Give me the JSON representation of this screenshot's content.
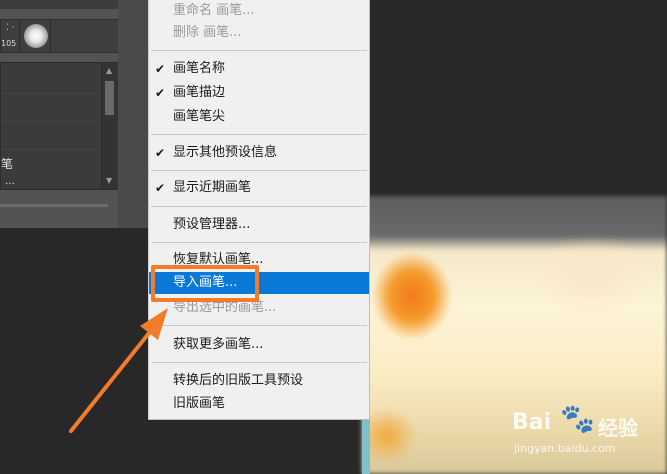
{
  "brush_panel": {
    "thumbnail_size": "105",
    "list_items": [
      "笔",
      "…"
    ]
  },
  "menu": {
    "items": [
      {
        "label": "重命名 画笔...",
        "checked": false,
        "disabled": true
      },
      {
        "label": "删除 画笔...",
        "checked": false,
        "disabled": true
      },
      {
        "label": "画笔名称",
        "checked": true,
        "disabled": false
      },
      {
        "label": "画笔描边",
        "checked": true,
        "disabled": false
      },
      {
        "label": "画笔笔尖",
        "checked": false,
        "disabled": false
      },
      {
        "label": "显示其他预设信息",
        "checked": true,
        "disabled": false
      },
      {
        "label": "显示近期画笔",
        "checked": true,
        "disabled": false
      },
      {
        "label": "预设管理器...",
        "checked": false,
        "disabled": false
      },
      {
        "label": "恢复默认画笔...",
        "checked": false,
        "disabled": false
      },
      {
        "label": "导入画笔...",
        "checked": false,
        "disabled": false,
        "highlighted": true
      },
      {
        "label": "导出选中的画笔...",
        "checked": false,
        "disabled": true
      },
      {
        "label": "获取更多画笔...",
        "checked": false,
        "disabled": false
      },
      {
        "label": "转换后的旧版工具预设",
        "checked": false,
        "disabled": false
      },
      {
        "label": "旧版画笔",
        "checked": false,
        "disabled": false
      }
    ],
    "check_glyph": "✔"
  },
  "watermark": {
    "logo_text": "Bai",
    "paw_glyph": "🐾",
    "cn_text": "经验",
    "url": "jingyan.baidu.com"
  },
  "colors": {
    "highlight": "#0a78d7",
    "annotation": "#f27c2b"
  }
}
